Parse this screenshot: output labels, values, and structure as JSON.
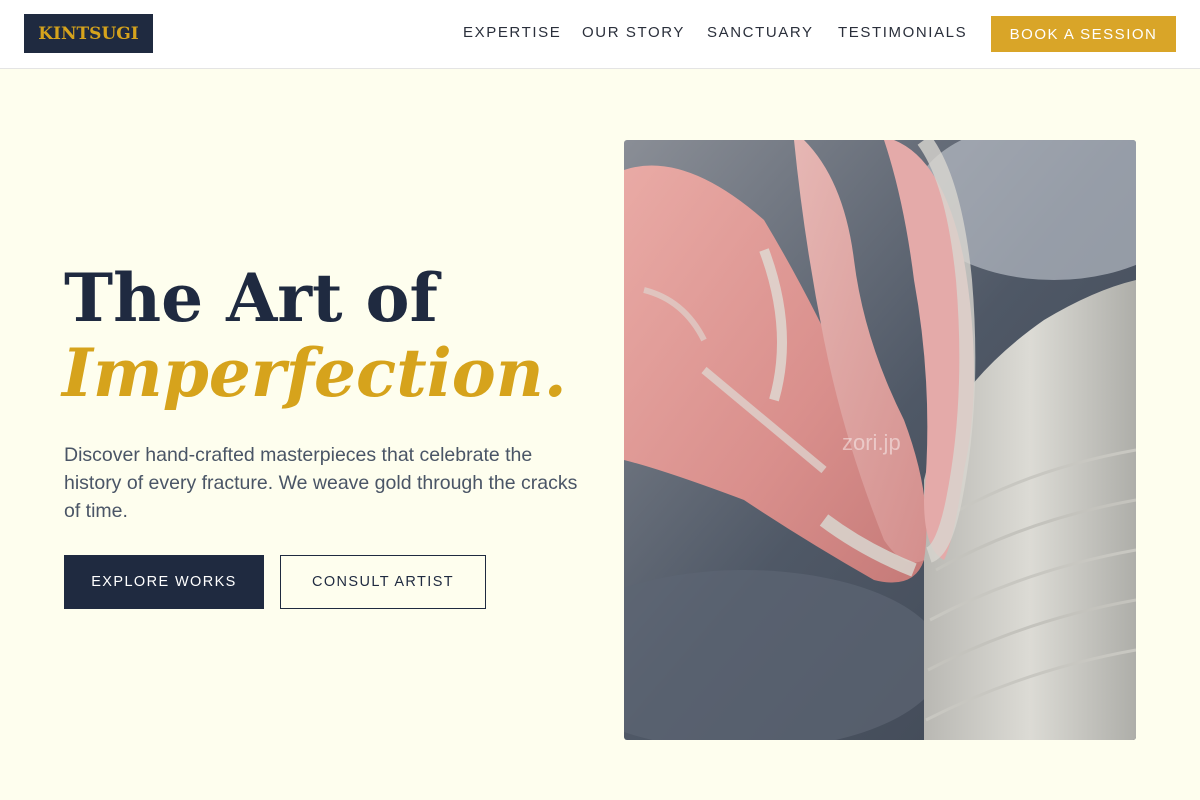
{
  "header": {
    "logo_text": "KINTSUGI",
    "nav": [
      "EXPERTISE",
      "OUR STORY",
      "SANCTUARY",
      "TESTIMONIALS"
    ],
    "cta_label": "BOOK A SESSION"
  },
  "hero": {
    "title_line1": "The Art of",
    "title_line2": "Imperfection.",
    "description": "Discover hand-crafted masterpieces that celebrate the history of every fracture. We weave gold through the cracks of time.",
    "primary_button": "EXPLORE WORKS",
    "secondary_button": "CONSULT ARTIST",
    "image_watermark": "zori.jp"
  },
  "colors": {
    "background": "#fefeee",
    "navy": "#1f2a40",
    "gold": "#d6a31c",
    "cta_gold": "#d9a528"
  },
  "icons": {
    "hero_image": "pottery-hands-image"
  }
}
